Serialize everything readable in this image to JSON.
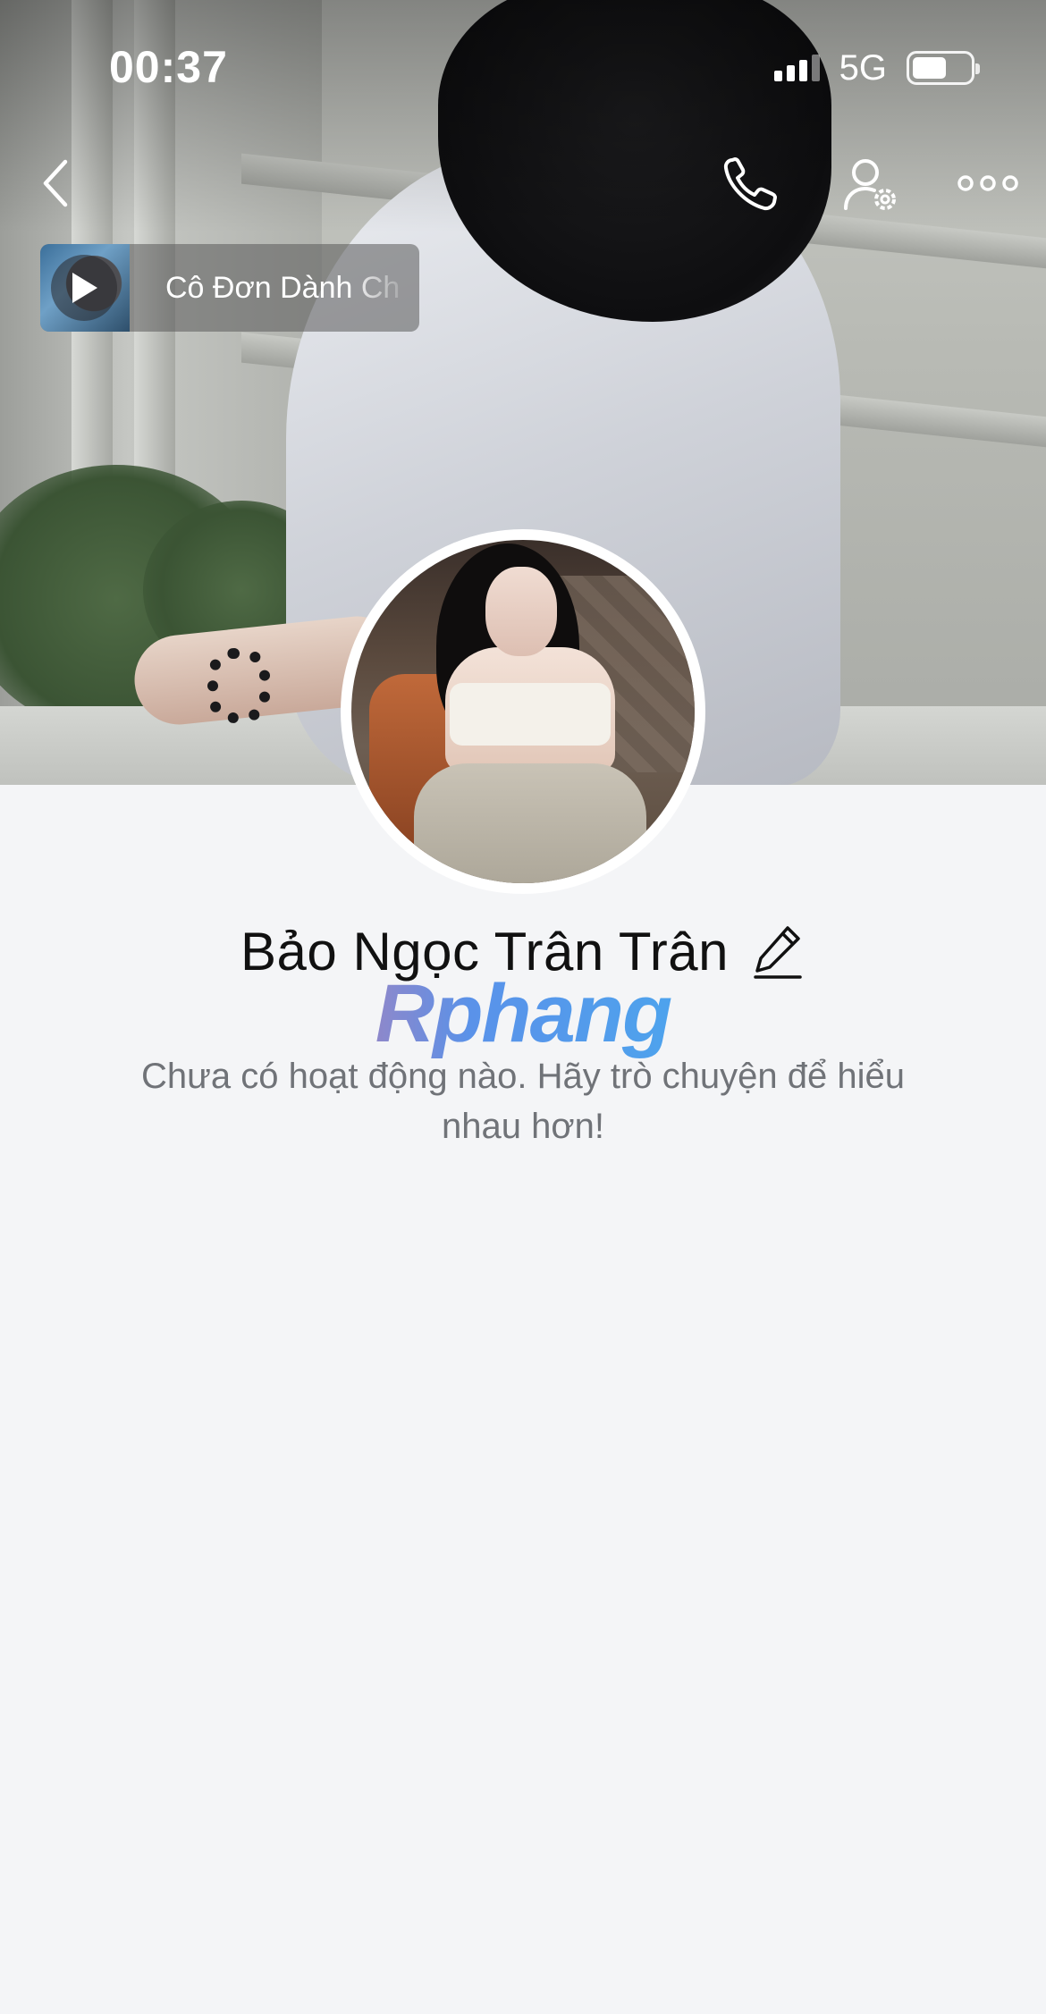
{
  "status_bar": {
    "time": "00:37",
    "network": "5G",
    "battery_level": 0.6
  },
  "header": {
    "back_icon": "chevron-left-icon",
    "call_icon": "phone-icon",
    "profile_settings_icon": "user-gear-icon",
    "more_icon": "more-horizontal-icon"
  },
  "music": {
    "title": "Cô Đơn Dành Ch",
    "play_icon": "play-icon"
  },
  "profile": {
    "name": "Bảo Ngọc Trân Trân",
    "edit_icon": "pencil-icon"
  },
  "watermark": {
    "text": "Rphang"
  },
  "feed": {
    "empty_message": "Chưa có hoạt động nào. Hãy trò chuyện để hiểu nhau hơn!"
  },
  "colors": {
    "background": "#f4f5f7",
    "text_primary": "#111111",
    "text_secondary": "#707378"
  }
}
